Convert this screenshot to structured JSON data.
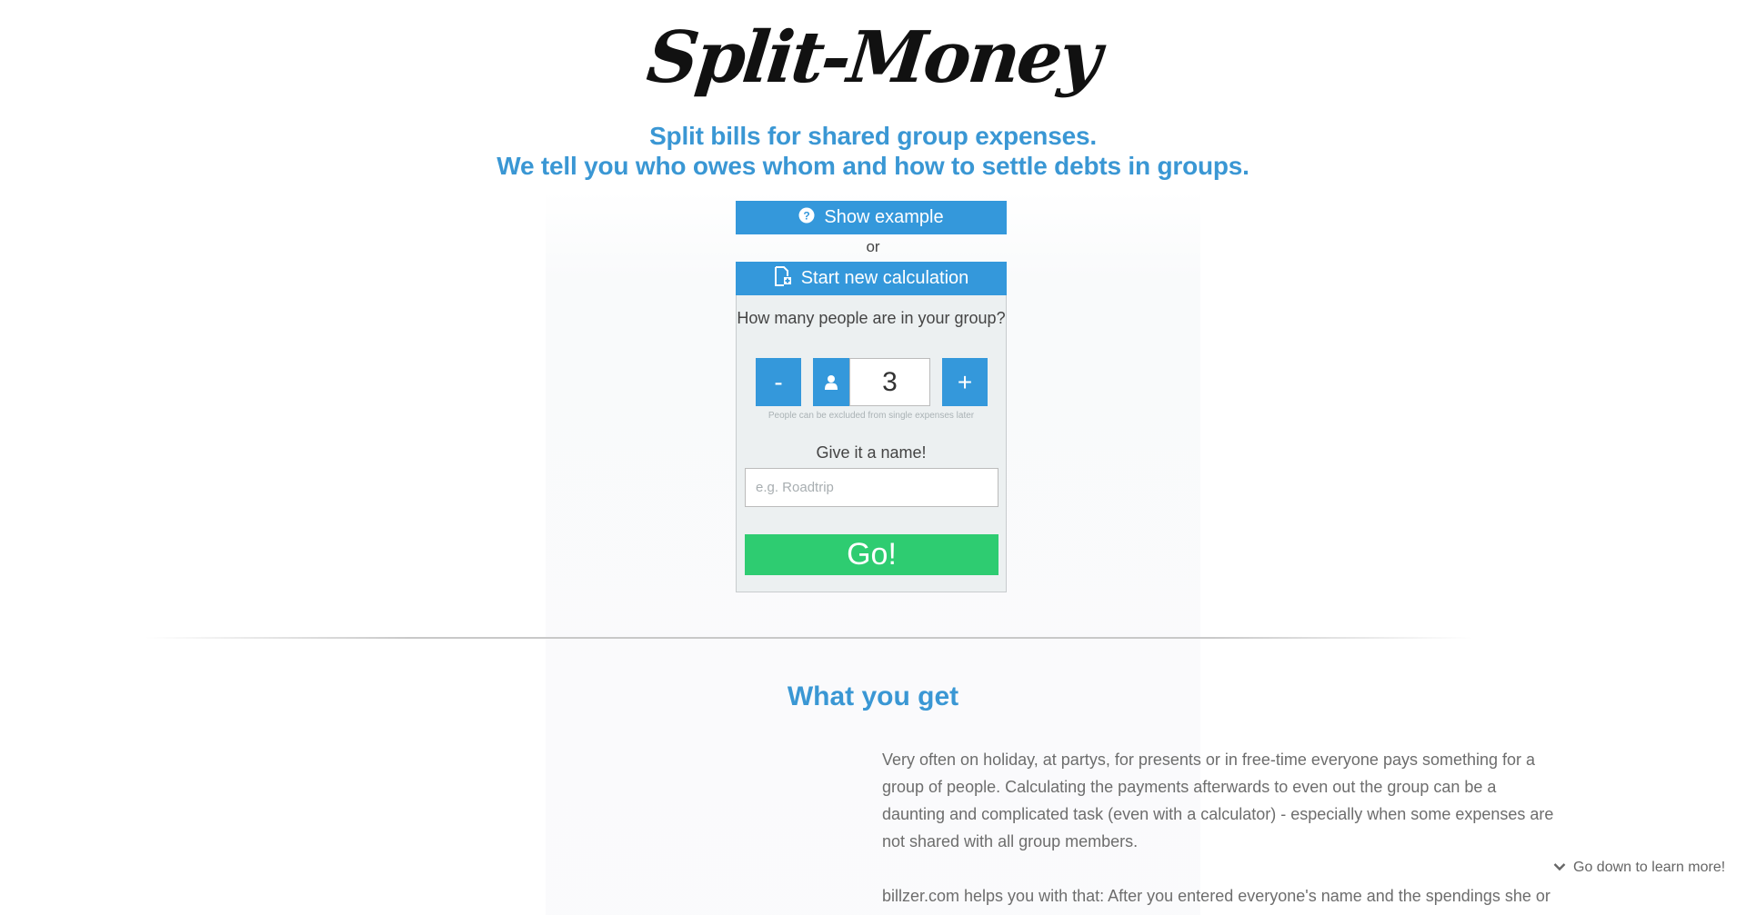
{
  "logo": "Split-Money",
  "tagline": {
    "line1": "Split bills for shared group expenses.",
    "line2": "We tell you who owes whom and how to settle debts in groups."
  },
  "actions": {
    "show_example": "Show example",
    "or": "or",
    "start_new": "Start new calculation"
  },
  "form": {
    "people_question": "How many people are in your group?",
    "minus_label": "-",
    "plus_label": "+",
    "people_count": "3",
    "people_hint": "People can be excluded from single expenses later",
    "name_label": "Give it a name!",
    "name_placeholder": "e.g. Roadtrip",
    "go_label": "Go!"
  },
  "section": {
    "title": "What you get",
    "paragraph1": "Very often on holiday, at partys, for presents or in free-time everyone pays something for a group of people. Calculating the payments afterwards to even out the group can be a daunting and complicated task (even with a calculator) - especially when some expenses are not shared with all group members.",
    "paragraph2": "billzer.com helps you with that: After you entered everyone's name and the spendings she or"
  },
  "scroll_hint": "Go down to learn more!",
  "icons": {
    "example": "question-circle-icon",
    "start": "new-document-icon",
    "person": "person-icon",
    "scroll": "chevron-down-icon"
  },
  "colors": {
    "accent_blue": "#3498db",
    "heading_blue": "#3a97d4",
    "go_green": "#2ecc71",
    "card_bg": "#ecf0f1"
  }
}
